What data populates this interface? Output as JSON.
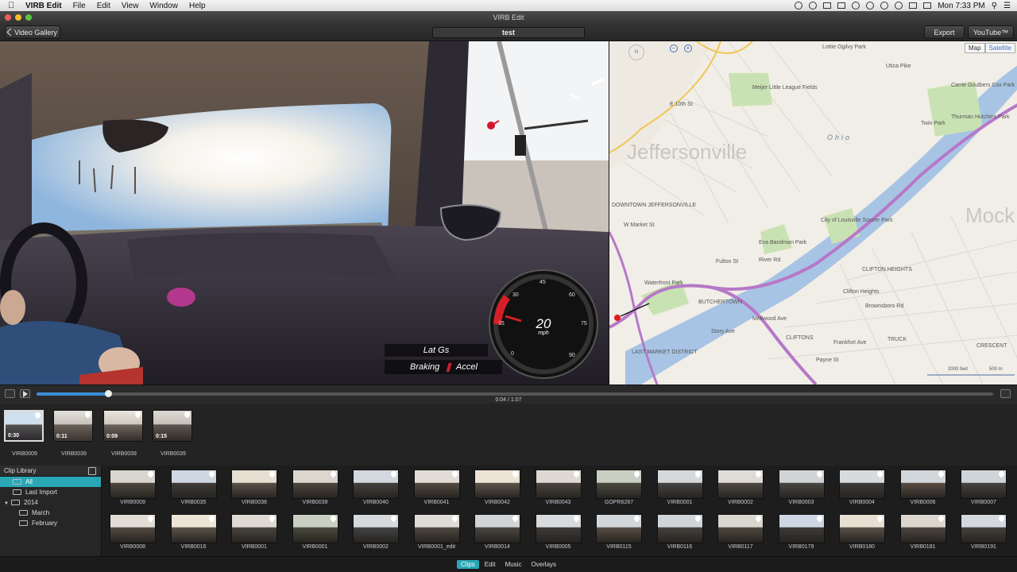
{
  "menubar": {
    "app": "VIRB Edit",
    "items": [
      "File",
      "Edit",
      "View",
      "Window",
      "Help"
    ],
    "clock": "Mon 7:33 PM"
  },
  "window": {
    "title": "VIRB Edit"
  },
  "toolbar": {
    "back_label": "Video Gallery",
    "project_title": "test",
    "export_label": "Export",
    "youtube_label": "YouTube™"
  },
  "overlay": {
    "lat_gs": "Lat Gs",
    "braking": "Braking",
    "accel": "Accel",
    "speed": "20",
    "speed_unit": "mph",
    "dial_ticks": [
      "0",
      "15",
      "30",
      "45",
      "60",
      "75",
      "90"
    ]
  },
  "map": {
    "tab_map": "Map",
    "tab_satellite": "Satellite",
    "labels": [
      "Jeffersonville",
      "DOWNTOWN JEFFERSONVILLE",
      "Ohio",
      "W Market St",
      "Waterfront Park",
      "BUTCHERTOWN",
      "LAST MARKET DISTRICT",
      "CLIFTON HEIGHTS",
      "CLIFTONS",
      "Clifton Heights",
      "CRESCENT",
      "Eva Bandman Park",
      "City of Louisville Soccer Park",
      "Meijer Little League Fields",
      "Lottie Ogilvy Park",
      "Carrie Goulbers Cox Park",
      "Thurman Hutchins Park",
      "Twin Park",
      "TRUCK",
      "Utica Pike",
      "River Rd",
      "E 10th St",
      "Story Ave",
      "Mellwood Ave",
      "Frankfort Ave",
      "Brownsboro Rd",
      "Payne St",
      "Fulton St",
      "Mock Vall"
    ],
    "scale": "2000 feet",
    "scale2": "500 m"
  },
  "timeline": {
    "time": "0:04 / 1:07",
    "progress": 0.075
  },
  "strip": [
    {
      "dur": "0:30",
      "name": "VIRB0009",
      "selected": true
    },
    {
      "dur": "0:11",
      "name": "VIRB0039"
    },
    {
      "dur": "0:09",
      "name": "VIRB0039"
    },
    {
      "dur": "0:15",
      "name": "VIRB0039"
    }
  ],
  "library": {
    "header": "Clip Library",
    "items": [
      {
        "label": "All",
        "selected": true
      },
      {
        "label": "Last Import"
      },
      {
        "label": "2014"
      },
      {
        "label": "March"
      },
      {
        "label": "February"
      }
    ]
  },
  "clips_row1": [
    "VIRB0009",
    "VIRB0035",
    "VIRB0038",
    "VIRB0039",
    "VIRB0040",
    "VIRB0041",
    "VIRB0042",
    "VIRB0043",
    "GOPR6287",
    "VIRB0001",
    "VIRB0002",
    "VIRB0003",
    "VIRB0004",
    "VIRB0006",
    "VIRB0007"
  ],
  "clips_row2": [
    "VIRB0008",
    "VIRB0016",
    "VIRB0001",
    "VIRB0001",
    "VIRB0002",
    "VIRB0001_edit",
    "VIRB0014",
    "VIRB0005",
    "VIRB0115",
    "VIRB0116",
    "VIRB0117",
    "VIRB0179",
    "VIRB0180",
    "VIRB0181",
    "VIRB0191"
  ],
  "bottom_tabs": [
    {
      "label": "Clips",
      "active": true
    },
    {
      "label": "Edit"
    },
    {
      "label": "Music"
    },
    {
      "label": "Overlays"
    }
  ]
}
